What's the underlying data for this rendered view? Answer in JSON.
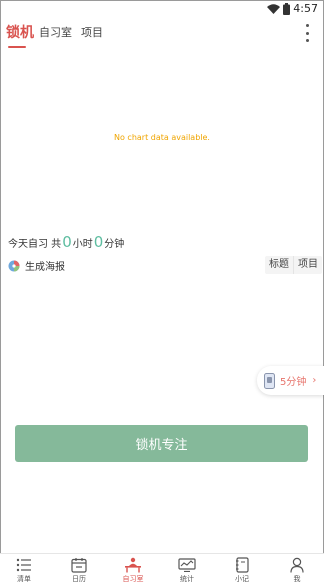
{
  "status_bar": {
    "time": "4:57"
  },
  "header": {
    "tabs": [
      {
        "label": "锁机",
        "active": true
      },
      {
        "label": "自习室",
        "active": false
      },
      {
        "label": "项目",
        "active": false
      }
    ]
  },
  "chart_placeholder": "No chart data available.",
  "today_summary": {
    "prefix": "今天自习  共",
    "hours": "0",
    "hours_unit": "小时",
    "minutes": "0",
    "minutes_unit": "分钟"
  },
  "poster": {
    "label": "生成海报"
  },
  "segment": {
    "options": [
      "标题",
      "项目"
    ]
  },
  "floating_timer": {
    "label": "5分钟",
    "chevron": "›"
  },
  "lock_button": {
    "label": "锁机专注"
  },
  "bottom_nav": {
    "items": [
      {
        "label": "清单",
        "icon": "list-icon"
      },
      {
        "label": "日历",
        "icon": "calendar-icon"
      },
      {
        "label": "自习室",
        "icon": "study-room-icon",
        "active": true
      },
      {
        "label": "统计",
        "icon": "stats-icon"
      },
      {
        "label": "小记",
        "icon": "notebook-icon"
      },
      {
        "label": "我",
        "icon": "person-icon"
      }
    ]
  },
  "colors": {
    "accent": "#d9534f",
    "button": "#85b99a",
    "teal": "#5dbda0",
    "orange": "#f0a500",
    "timer": "#e7746c"
  }
}
